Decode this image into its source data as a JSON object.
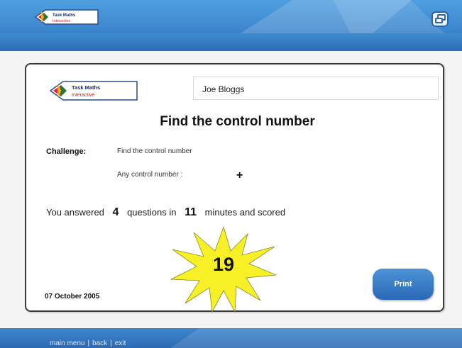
{
  "app": {
    "logo_title": "Task Maths",
    "logo_subtitle": "Interactive"
  },
  "certificate": {
    "student_name": "Joe Bloggs",
    "title": "Find the control number",
    "challenge_label": "Challenge:",
    "challenge_text": "Find the control number",
    "control_label": "Any control number :",
    "control_value": "+",
    "summary_prefix": "You answered",
    "questions_count": "4",
    "summary_mid": "questions in",
    "minutes": "11",
    "summary_suffix": "minutes and scored",
    "score": "19",
    "date": "07 October 2005",
    "print_label": "Print"
  },
  "footer": {
    "main_menu": "main menu",
    "back": "back",
    "exit": "exit",
    "separator": "|"
  },
  "colors": {
    "header_blue": "#3e88cf",
    "button_blue": "#2968b4",
    "star_yellow": "#f7f027"
  }
}
